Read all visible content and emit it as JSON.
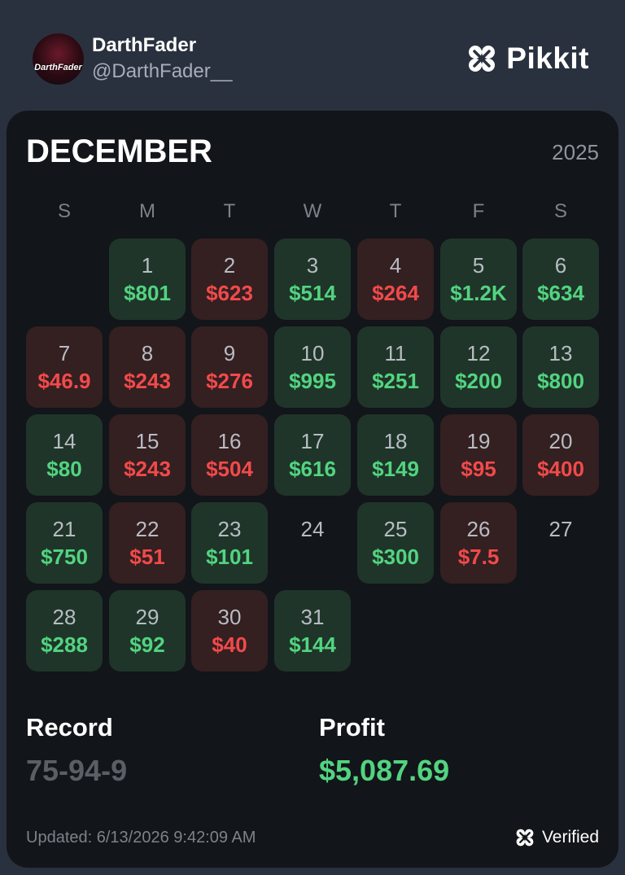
{
  "profile": {
    "display_name": "DarthFader",
    "handle": "@DarthFader__",
    "avatar_text": "DarthFader"
  },
  "brand": {
    "name": "Pikkit",
    "icon": "clover-logo-icon"
  },
  "calendar": {
    "month": "DECEMBER",
    "year": "2025",
    "weekdays": [
      "S",
      "M",
      "T",
      "W",
      "T",
      "F",
      "S"
    ],
    "start_weekday": 1,
    "days": [
      {
        "day": "1",
        "amount": "$801",
        "result": "win"
      },
      {
        "day": "2",
        "amount": "$623",
        "result": "loss"
      },
      {
        "day": "3",
        "amount": "$514",
        "result": "win"
      },
      {
        "day": "4",
        "amount": "$264",
        "result": "loss"
      },
      {
        "day": "5",
        "amount": "$1.2K",
        "result": "win"
      },
      {
        "day": "6",
        "amount": "$634",
        "result": "win"
      },
      {
        "day": "7",
        "amount": "$46.9",
        "result": "loss"
      },
      {
        "day": "8",
        "amount": "$243",
        "result": "loss"
      },
      {
        "day": "9",
        "amount": "$276",
        "result": "loss"
      },
      {
        "day": "10",
        "amount": "$995",
        "result": "win"
      },
      {
        "day": "11",
        "amount": "$251",
        "result": "win"
      },
      {
        "day": "12",
        "amount": "$200",
        "result": "win"
      },
      {
        "day": "13",
        "amount": "$800",
        "result": "win"
      },
      {
        "day": "14",
        "amount": "$80",
        "result": "win"
      },
      {
        "day": "15",
        "amount": "$243",
        "result": "loss"
      },
      {
        "day": "16",
        "amount": "$504",
        "result": "loss"
      },
      {
        "day": "17",
        "amount": "$616",
        "result": "win"
      },
      {
        "day": "18",
        "amount": "$149",
        "result": "win"
      },
      {
        "day": "19",
        "amount": "$95",
        "result": "loss"
      },
      {
        "day": "20",
        "amount": "$400",
        "result": "loss"
      },
      {
        "day": "21",
        "amount": "$750",
        "result": "win"
      },
      {
        "day": "22",
        "amount": "$51",
        "result": "loss"
      },
      {
        "day": "23",
        "amount": "$101",
        "result": "win"
      },
      {
        "day": "24",
        "amount": "",
        "result": "none"
      },
      {
        "day": "25",
        "amount": "$300",
        "result": "win"
      },
      {
        "day": "26",
        "amount": "$7.5",
        "result": "loss"
      },
      {
        "day": "27",
        "amount": "",
        "result": "none"
      },
      {
        "day": "28",
        "amount": "$288",
        "result": "win"
      },
      {
        "day": "29",
        "amount": "$92",
        "result": "win"
      },
      {
        "day": "30",
        "amount": "$40",
        "result": "loss"
      },
      {
        "day": "31",
        "amount": "$144",
        "result": "win"
      }
    ]
  },
  "summary": {
    "record_label": "Record",
    "record_value": "75-94-9",
    "profit_label": "Profit",
    "profit_value": "$5,087.69"
  },
  "footer": {
    "updated": "Updated: 6/13/2026 9:42:09 AM",
    "verified_label": "Verified",
    "verified_icon": "clover-verified-icon"
  },
  "colors": {
    "background": "#2a313e",
    "card": "#121519",
    "win_tile": "#1f3529",
    "loss_tile": "#341f21",
    "win_text": "#52d480",
    "loss_text": "#f24a4a"
  }
}
